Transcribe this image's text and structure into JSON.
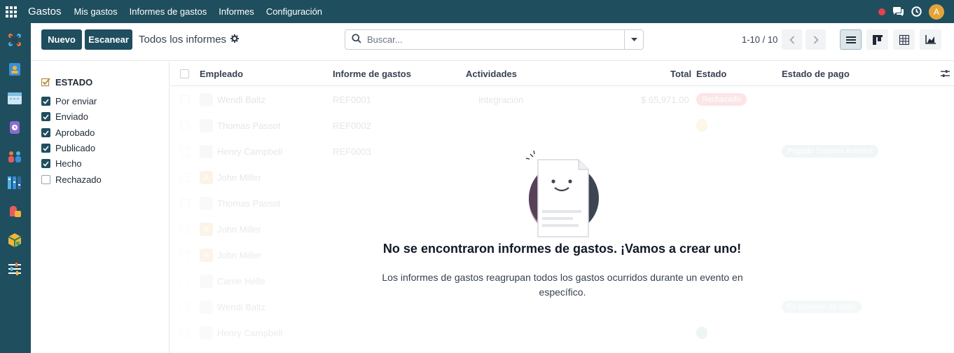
{
  "topbar": {
    "app_name": "Gastos",
    "menu": [
      "Mis gastos",
      "Informes de gastos",
      "Informes",
      "Configuración"
    ],
    "user_initial": "A",
    "colors": {
      "bar": "#1f4e5f",
      "notification": "#e5434b",
      "avatar": "#e4a33a"
    }
  },
  "dock": {
    "icons": [
      "discuss-icon",
      "contacts-icon",
      "calendar-icon",
      "timesheet-icon",
      "employees-icon",
      "project-icon",
      "expenses-icon",
      "inventory-icon",
      "settings-icon"
    ]
  },
  "control": {
    "new_label": "Nuevo",
    "scan_label": "Escanear",
    "breadcrumb": "Todos los informes",
    "search_placeholder": "Buscar...",
    "pager": "1-10 / 10",
    "views": [
      "list-view-icon",
      "kanban-view-icon",
      "pivot-view-icon",
      "graph-view-icon"
    ]
  },
  "filters": {
    "heading": "ESTADO",
    "items": [
      {
        "label": "Por enviar",
        "checked": true
      },
      {
        "label": "Enviado",
        "checked": true
      },
      {
        "label": "Aprobado",
        "checked": true
      },
      {
        "label": "Publicado",
        "checked": true
      },
      {
        "label": "Hecho",
        "checked": true
      },
      {
        "label": "Rechazado",
        "checked": false
      }
    ]
  },
  "list": {
    "columns": [
      "Empleado",
      "Informe de gastos",
      "Actividades",
      "Total",
      "Estado",
      "Estado de pago"
    ],
    "rows": [
      {
        "employee": "Wendi Baltz",
        "avatar": "cam",
        "report": "REF0001",
        "activity": "Integración",
        "total": "$ 65,971.00",
        "state": "Rechazado",
        "state_color": "#e5434b",
        "payment": ""
      },
      {
        "employee": "Thomas Passot",
        "avatar": "cam",
        "report": "REF0002",
        "activity": "",
        "total": "",
        "state": "",
        "state_color": "#f5c04a",
        "payment": ""
      },
      {
        "employee": "Henry Campbell",
        "avatar": "cam",
        "report": "REF0003",
        "activity": "",
        "total": "",
        "state": "",
        "state_color": "",
        "payment": "Pagado Sistema Anterior"
      },
      {
        "employee": "John Miller",
        "avatar": "letter",
        "report": "",
        "activity": "",
        "total": "",
        "state": "",
        "state_color": "",
        "payment": ""
      },
      {
        "employee": "Thomas Passot",
        "avatar": "cam",
        "report": "",
        "activity": "",
        "total": "",
        "state": "",
        "state_color": "",
        "payment": ""
      },
      {
        "employee": "John Miller",
        "avatar": "letter",
        "report": "",
        "activity": "",
        "total": "",
        "state": "",
        "state_color": "",
        "payment": ""
      },
      {
        "employee": "John Miller",
        "avatar": "letter",
        "report": "",
        "activity": "",
        "total": "",
        "state": "",
        "state_color": "",
        "payment": ""
      },
      {
        "employee": "Carrie Helle",
        "avatar": "cam",
        "report": "",
        "activity": "",
        "total": "",
        "state": "",
        "state_color": "",
        "payment": ""
      },
      {
        "employee": "Wendi Baltz",
        "avatar": "cam",
        "report": "",
        "activity": "",
        "total": "",
        "state": "",
        "state_color": "",
        "payment": "En proceso de pago"
      },
      {
        "employee": "Henry Campbell",
        "avatar": "cam",
        "report": "",
        "activity": "",
        "total": "",
        "state": "",
        "state_color": "#4caf7a",
        "payment": ""
      }
    ]
  },
  "empty_state": {
    "title": "No se encontraron informes de gastos. ¡Vamos a crear uno!",
    "text": "Los informes de gastos reagrupan todos los gastos ocurridos durante un evento en específico."
  }
}
